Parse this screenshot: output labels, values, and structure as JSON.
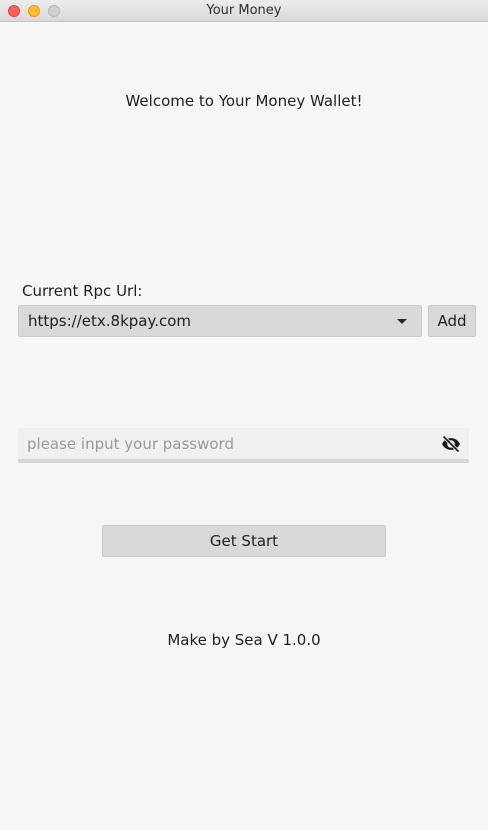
{
  "window": {
    "title": "Your Money"
  },
  "main": {
    "welcome": "Welcome to Your Money Wallet!",
    "rpc_label": "Current Rpc Url:",
    "rpc_selected": "https://etx.8kpay.com",
    "add_label": "Add",
    "password_placeholder": "please input your password",
    "password_value": "",
    "start_label": "Get Start",
    "footer": "Make by Sea V 1.0.0"
  },
  "icons": {
    "password_toggle": "eye-off-icon",
    "dropdown": "chevron-down-icon"
  }
}
